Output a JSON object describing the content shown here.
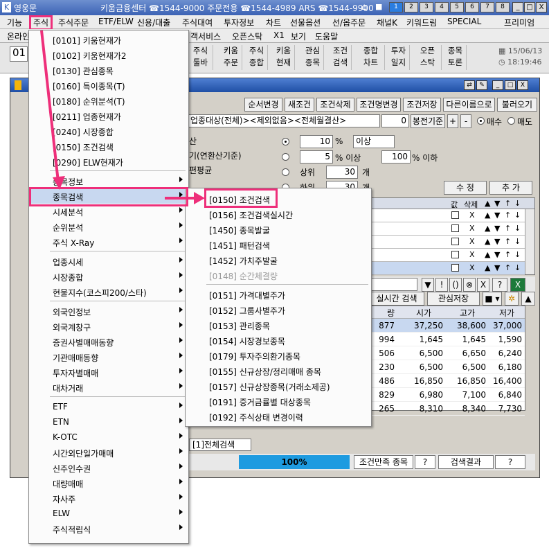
{
  "titlebar": {
    "app": "영웅문",
    "hotline": "키움금융센터 ☎1544-9000 주문전용 ☎1544-4989 ARS ☎1544-9900",
    "num_buttons": [
      "1",
      "2",
      "3",
      "4",
      "5",
      "6",
      "7",
      "8"
    ],
    "min": "_",
    "max": "□",
    "close": "X"
  },
  "menubar": [
    "기능",
    "주식",
    "주식주문",
    "ETF/ELW",
    "신용/대출",
    "주식대여",
    "투자정보",
    "차트",
    "선물옵션",
    "선/옵주문",
    "채널K",
    "키워드림",
    "SPECIAL",
    "프리미엄"
  ],
  "menubar2": [
    "온라인",
    "객서비스",
    "오픈스탁",
    "X1",
    "보기",
    "도움말"
  ],
  "toolbar": {
    "left_input": "01",
    "buttons": [
      [
        "주식",
        "툴바"
      ],
      [
        "키움",
        "주문"
      ],
      [
        "주식",
        "종합"
      ],
      [
        "키움",
        "현재"
      ],
      [
        "관심",
        "종목"
      ],
      [
        "조건",
        "검색"
      ],
      [
        "종합",
        "차트"
      ],
      [
        "투자",
        "일지"
      ],
      [
        "오픈",
        "스탁"
      ],
      [
        "종목",
        "토론"
      ]
    ],
    "date": "15/06/13",
    "time": "18:19:46"
  },
  "child": {
    "buttons": [
      "순서변경",
      "새조건",
      "조건삭제",
      "조건명변경",
      "조건저장",
      "다른이름으로",
      "불러오기"
    ],
    "target_field": "업종대상(전체)><제외없음><전체월결산>",
    "stepper_value": "0",
    "bongjeon_btn": "봉전기준",
    "plus": "+",
    "minus": "-",
    "buy_label": "매수",
    "sell_label": "매도",
    "left_texts": [
      "산",
      "기(연환산기준)",
      "편평균"
    ],
    "opt1": {
      "value": "10",
      "unit": "%",
      "select": "이상"
    },
    "opt2": {
      "value": "5",
      "unit": "% 이상",
      "value2": "100",
      "unit2": "% 이하"
    },
    "opt3": {
      "label": "상위",
      "value": "30",
      "unit": "개"
    },
    "opt4": {
      "label": "하위",
      "value": "30",
      "unit": "개"
    },
    "edit_btn": "수 정",
    "add_btn": "추 가",
    "grid_headers": [
      "값",
      "삭제",
      "▲",
      "▼",
      "↑",
      "↓"
    ],
    "grid_rows": 5,
    "realtime_btn": "실시간 검색",
    "save_fav_btn": "관심저장",
    "result_headers": [
      "량",
      "시가",
      "고가",
      "저가"
    ],
    "result_rows": [
      [
        "877",
        "37,250",
        "38,600",
        "37,000"
      ],
      [
        "994",
        "1,645",
        "1,645",
        "1,590"
      ],
      [
        "506",
        "6,500",
        "6,650",
        "6,240"
      ],
      [
        "230",
        "6,500",
        "6,500",
        "6,180"
      ],
      [
        "486",
        "16,850",
        "16,850",
        "16,400"
      ],
      [
        "829",
        "6,980",
        "7,100",
        "6,840"
      ],
      [
        "265",
        "8,310",
        "8,340",
        "7,730"
      ]
    ],
    "tab_label": "[1]전체검색",
    "progress": "100%",
    "status_label": "조건만족 종목",
    "status_q": "?",
    "status_result": "검색결과",
    "status_q2": "?"
  },
  "menu1": {
    "group1": [
      "[0101] 키움현재가",
      "[0102] 키움현재가2",
      "[0130] 관심종목",
      "[0160] 특이종목(T)",
      "[0180] 순위분석(T)",
      "[0211] 업종현재가",
      "[0240] 시장종합",
      "[0150] 조건검색",
      "[0290] ELW현재가"
    ],
    "group2": [
      "종목정보",
      "종목검색",
      "시세분석",
      "순위분석",
      "주식 X-Ray"
    ],
    "group3": [
      "업종시세",
      "시장종합",
      "현물지수(코스피200/스타)"
    ],
    "group4": [
      "외국인정보",
      "외국계창구",
      "증권사별매매동향",
      "기관매매동향",
      "투자자별매매",
      "대차거래"
    ],
    "group5": [
      "ETF",
      "ETN",
      "K-OTC",
      "시간외단일가매매",
      "신주인수권",
      "대량매매",
      "자사주",
      "ELW",
      "주식적립식"
    ]
  },
  "menu2": {
    "group1": [
      "[0150] 조건검색",
      "[0156] 조건검색실시간",
      "[1450] 종목발굴",
      "[1451] 패턴검색",
      "[1452] 가치주발굴",
      "[0148] 순간체결량"
    ],
    "group2": [
      "[0151] 가격대별주가",
      "[0152] 그룹사별주가",
      "[0153] 관리종목",
      "[0154] 시장경보종목",
      "[0179] 투자주의환기종목",
      "[0155] 신규상장/정리매매 종목",
      "[0157] 신규상장종목(거래소제공)",
      "[0191] 증거금률별 대상종목",
      "[0192] 주식상태 변경이력"
    ]
  },
  "colors": {
    "highlight": "#ee2f7a",
    "selection": "#c8d8f0",
    "title": "#3c63b5",
    "progress": "#1e9be0"
  }
}
